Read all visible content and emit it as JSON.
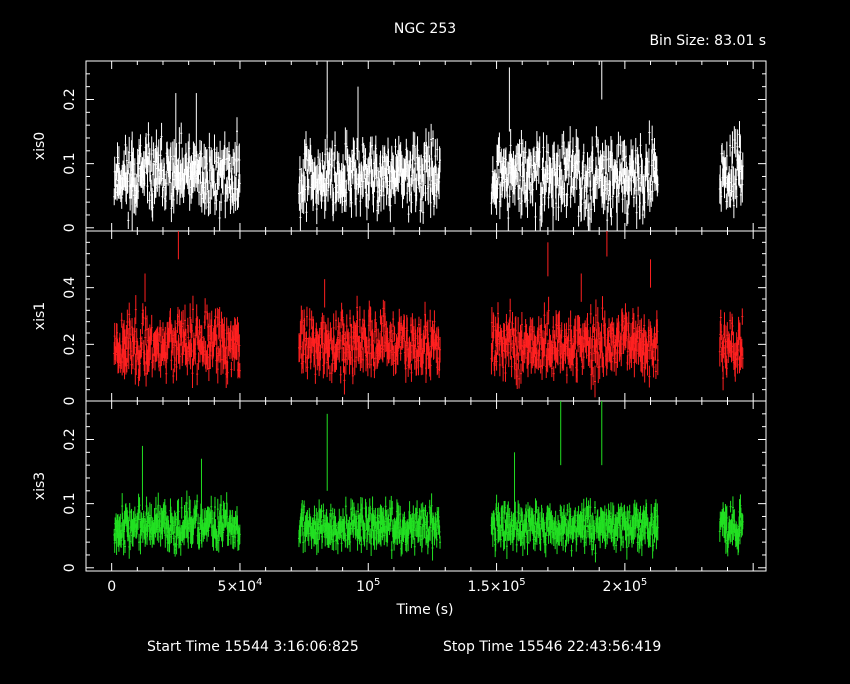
{
  "header": {
    "title": "NGC 253",
    "bin_size": "Bin Size: 83.01 s"
  },
  "footer": {
    "start_time": "Start Time 15544  3:16:06:825",
    "stop_time": "Stop Time 15546 22:43:56:419"
  },
  "chart_data": {
    "type": "scatter",
    "xlabel": "Time (s)",
    "xlim": [
      -10000,
      255000
    ],
    "x_ticks": [
      {
        "value": 0,
        "base": "0",
        "exp": ""
      },
      {
        "value": 50000,
        "base": "5×10",
        "exp": "4"
      },
      {
        "value": 100000,
        "base": "10",
        "exp": "5"
      },
      {
        "value": 150000,
        "base": "1.5×10",
        "exp": "5"
      },
      {
        "value": 200000,
        "base": "2×10",
        "exp": "5"
      }
    ],
    "segments": [
      [
        1000,
        50000
      ],
      [
        73000,
        128000
      ],
      [
        148000,
        213000
      ],
      [
        237000,
        246000
      ]
    ],
    "panels": [
      {
        "name": "xis0",
        "color": "#ffffff",
        "ylim": [
          -0.005,
          0.26
        ],
        "y_ticks": [
          "0",
          "0.1",
          "0.2"
        ],
        "y_tick_values": [
          0,
          0.1,
          0.2
        ],
        "mean": 0.08,
        "spread": 0.025,
        "err": 0.02,
        "seed": 11,
        "spikes": [
          [
            8000,
            0.03,
            0.12
          ],
          [
            25000,
            0.16,
            0.05
          ],
          [
            33000,
            0.16,
            0.05
          ],
          [
            84000,
            0.2,
            0.06
          ],
          [
            96000,
            0.17,
            0.05
          ],
          [
            155000,
            0.2,
            0.05
          ],
          [
            172000,
            0.04,
            0.05
          ],
          [
            191000,
            0.25,
            0.05
          ],
          [
            197000,
            0.01,
            0.04
          ]
        ]
      },
      {
        "name": "xis1",
        "color": "#ff2020",
        "ylim": [
          0.0,
          0.6
        ],
        "y_ticks": [
          "0",
          "0.2",
          "0.4"
        ],
        "y_tick_values": [
          0,
          0.2,
          0.4
        ],
        "mean": 0.2,
        "spread": 0.05,
        "err": 0.04,
        "seed": 23,
        "spikes": [
          [
            13000,
            0.4,
            0.05
          ],
          [
            26000,
            0.56,
            0.06
          ],
          [
            83000,
            0.38,
            0.05
          ],
          [
            170000,
            0.5,
            0.06
          ],
          [
            183000,
            0.4,
            0.05
          ],
          [
            193000,
            0.56,
            0.05
          ],
          [
            210000,
            0.45,
            0.05
          ]
        ]
      },
      {
        "name": "xis3",
        "color": "#22e022",
        "ylim": [
          -0.005,
          0.26
        ],
        "y_ticks": [
          "0",
          "0.1",
          "0.2"
        ],
        "y_tick_values": [
          0,
          0.1,
          0.2
        ],
        "mean": 0.065,
        "spread": 0.015,
        "err": 0.015,
        "seed": 37,
        "spikes": [
          [
            12000,
            0.14,
            0.05
          ],
          [
            35000,
            0.12,
            0.05
          ],
          [
            84000,
            0.18,
            0.06
          ],
          [
            175000,
            0.24,
            0.08
          ],
          [
            191000,
            0.24,
            0.08
          ],
          [
            157000,
            0.13,
            0.05
          ]
        ]
      }
    ]
  }
}
